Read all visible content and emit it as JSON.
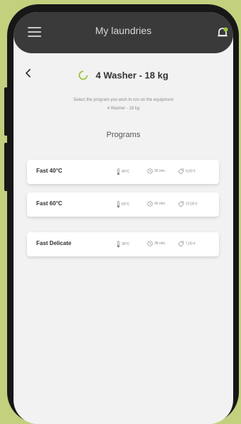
{
  "colors": {
    "background": "#c3d07e",
    "phone_frame": "#171717",
    "screen_bg": "#f2f2f2",
    "topbar": "#3a3a3a",
    "accent": "#9bc53d"
  },
  "header": {
    "title": "My laundries",
    "menu_icon": "hamburger-menu-icon",
    "notification_icon": "bell-icon"
  },
  "machine": {
    "back_icon": "chevron-left-icon",
    "status_icon": "loading-circle-icon",
    "name": "4 Washer - 18 kg",
    "instruction": "Select the program you wish to run on the equipment",
    "instruction_sub": "4 Washer - 18 kg"
  },
  "programs": {
    "title": "Programs",
    "items": [
      {
        "name": "Fast 40°C",
        "temperature": "40°C",
        "duration": "35 min.",
        "price": "9,00 €"
      },
      {
        "name": "Fast 60°C",
        "temperature": "60°C",
        "duration": "40 min.",
        "price": "10,00 €"
      },
      {
        "name": "Fast Delicate",
        "temperature": "30°C",
        "duration": "38 min.",
        "price": "7,00 €"
      }
    ]
  }
}
